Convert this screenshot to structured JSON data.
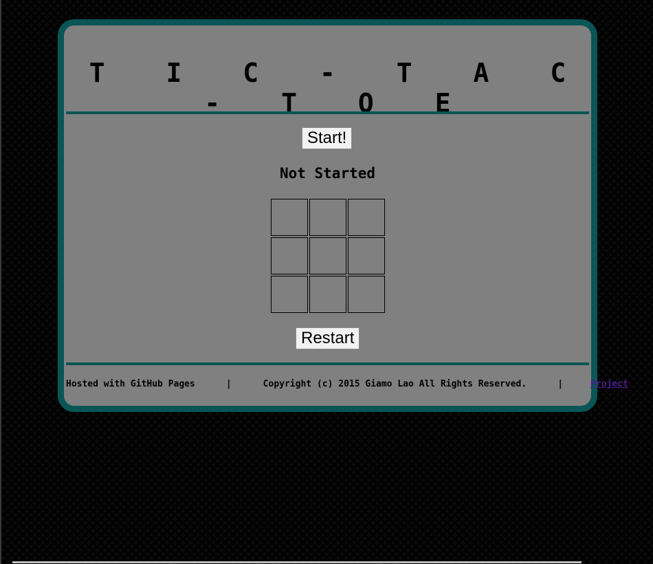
{
  "page": {
    "title": "T I C - T A C - T O E"
  },
  "controls": {
    "start_label": "Start!",
    "restart_label": "Restart"
  },
  "status": {
    "text": "Not Started"
  },
  "board": {
    "cells": [
      "",
      "",
      "",
      "",
      "",
      "",
      "",
      "",
      ""
    ]
  },
  "footer": {
    "hosted": "Hosted with GitHub Pages",
    "separator": "|",
    "copyright": "Copyright (c) 2015 Giamo Lao All Rights Reserved.",
    "project_link": "Project"
  },
  "colors": {
    "panel_background": "#808080",
    "panel_border": "#0a5555",
    "link": "#4b1c8c"
  }
}
